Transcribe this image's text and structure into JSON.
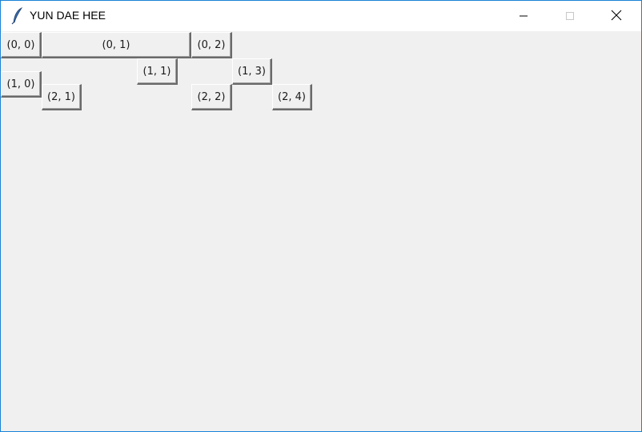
{
  "window": {
    "title": "YUN DAE HEE",
    "accent_color": "#1883d7",
    "icon": "feather-icon"
  },
  "controls": {
    "minimize": "minimize-icon",
    "maximize": "maximize-icon",
    "close": "close-icon"
  },
  "buttons": [
    {
      "label": "(0, 0)"
    },
    {
      "label": "(0, 1)"
    },
    {
      "label": "(0, 2)"
    },
    {
      "label": "(1, 0)"
    },
    {
      "label": "(1, 1)"
    },
    {
      "label": "(1, 3)"
    },
    {
      "label": "(2, 1)"
    },
    {
      "label": "(2, 2)"
    },
    {
      "label": "(2, 4)"
    }
  ]
}
